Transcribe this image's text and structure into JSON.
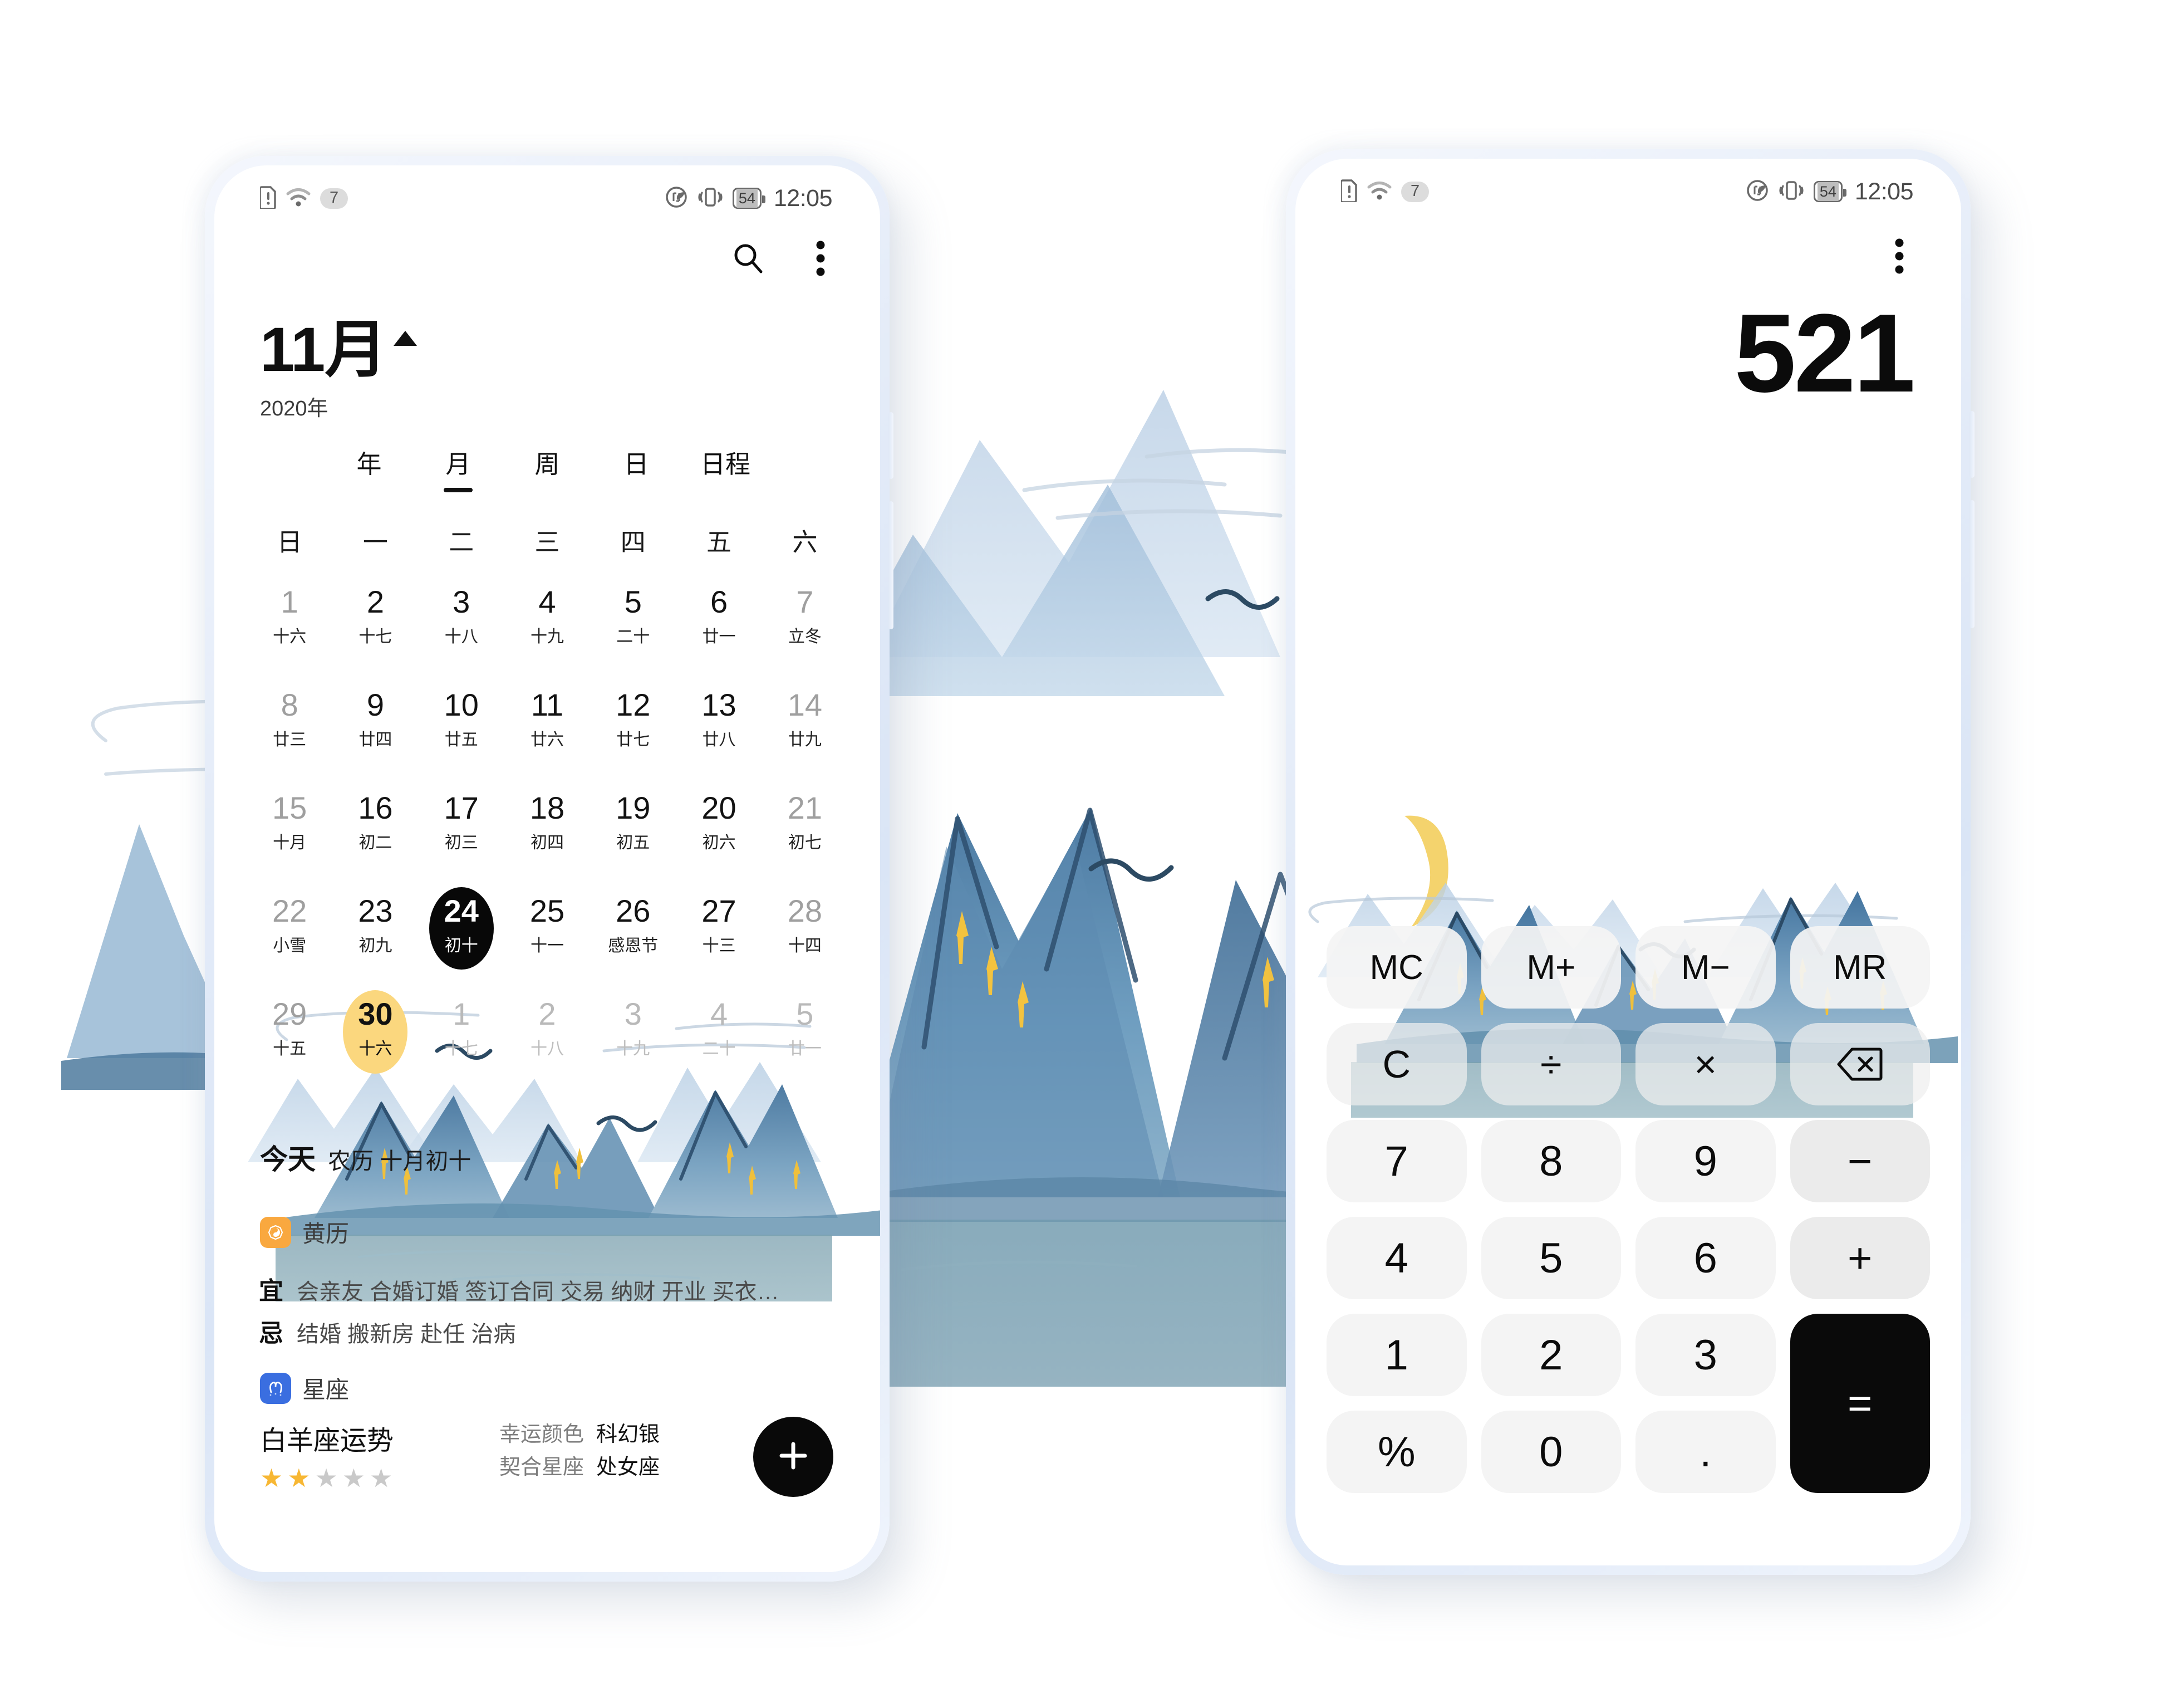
{
  "statusbar": {
    "wifi_count": "7",
    "battery": "54",
    "time": "12:05",
    "icons": [
      "sim-alert-icon",
      "wifi-icon",
      "data-saver-icon",
      "vibrate-icon",
      "battery-icon"
    ]
  },
  "calendar": {
    "search_icon": "search-icon",
    "more_icon": "more-vertical-icon",
    "month": "11月",
    "year": "2020年",
    "tabs": [
      {
        "label": "年",
        "active": false
      },
      {
        "label": "月",
        "active": true
      },
      {
        "label": "周",
        "active": false
      },
      {
        "label": "日",
        "active": false
      },
      {
        "label": "日程",
        "active": false
      }
    ],
    "weekdays": [
      "日",
      "一",
      "二",
      "三",
      "四",
      "五",
      "六"
    ],
    "days": [
      {
        "num": "1",
        "lunar": "十六",
        "state": "weekend"
      },
      {
        "num": "2",
        "lunar": "十七",
        "state": ""
      },
      {
        "num": "3",
        "lunar": "十八",
        "state": ""
      },
      {
        "num": "4",
        "lunar": "十九",
        "state": ""
      },
      {
        "num": "5",
        "lunar": "二十",
        "state": ""
      },
      {
        "num": "6",
        "lunar": "廿一",
        "state": ""
      },
      {
        "num": "7",
        "lunar": "立冬",
        "state": "weekend"
      },
      {
        "num": "8",
        "lunar": "廿三",
        "state": "weekend"
      },
      {
        "num": "9",
        "lunar": "廿四",
        "state": ""
      },
      {
        "num": "10",
        "lunar": "廿五",
        "state": ""
      },
      {
        "num": "11",
        "lunar": "廿六",
        "state": ""
      },
      {
        "num": "12",
        "lunar": "廿七",
        "state": ""
      },
      {
        "num": "13",
        "lunar": "廿八",
        "state": ""
      },
      {
        "num": "14",
        "lunar": "廿九",
        "state": "weekend"
      },
      {
        "num": "15",
        "lunar": "十月",
        "state": "weekend"
      },
      {
        "num": "16",
        "lunar": "初二",
        "state": ""
      },
      {
        "num": "17",
        "lunar": "初三",
        "state": ""
      },
      {
        "num": "18",
        "lunar": "初四",
        "state": ""
      },
      {
        "num": "19",
        "lunar": "初五",
        "state": ""
      },
      {
        "num": "20",
        "lunar": "初六",
        "state": ""
      },
      {
        "num": "21",
        "lunar": "初七",
        "state": "weekend"
      },
      {
        "num": "22",
        "lunar": "小雪",
        "state": "weekend"
      },
      {
        "num": "23",
        "lunar": "初九",
        "state": ""
      },
      {
        "num": "24",
        "lunar": "初十",
        "state": "selected"
      },
      {
        "num": "25",
        "lunar": "十一",
        "state": ""
      },
      {
        "num": "26",
        "lunar": "感恩节",
        "state": ""
      },
      {
        "num": "27",
        "lunar": "十三",
        "state": ""
      },
      {
        "num": "28",
        "lunar": "十四",
        "state": "weekend"
      },
      {
        "num": "29",
        "lunar": "十五",
        "state": "weekend"
      },
      {
        "num": "30",
        "lunar": "十六",
        "state": "today"
      },
      {
        "num": "1",
        "lunar": "十七",
        "state": "dim"
      },
      {
        "num": "2",
        "lunar": "十八",
        "state": "dim"
      },
      {
        "num": "3",
        "lunar": "十九",
        "state": "dim"
      },
      {
        "num": "4",
        "lunar": "二十",
        "state": "dim"
      },
      {
        "num": "5",
        "lunar": "廿一",
        "state": "dim"
      }
    ],
    "today_label": "今天",
    "today_lunar": "农历 十月初十",
    "almanac": {
      "badge_icon": "bagua-yinyang-icon",
      "badge_color": "#f9a83f",
      "title": "黄历",
      "good_key": "宜",
      "good_value": "会亲友 合婚订婚 签订合同 交易 纳财 开业 买衣…",
      "bad_key": "忌",
      "bad_value": "结婚 搬新房 赴任 治病"
    },
    "zodiac": {
      "badge_icon": "aries-icon",
      "badge_color": "#3a6ee0",
      "title": "星座",
      "sign_label": "白羊座运势",
      "rating": 2,
      "rating_max": 5,
      "star_on_color": "#f7b733",
      "star_off_color": "#c9c9c9",
      "lucky_color_key": "幸运颜色",
      "lucky_color_value": "科幻银",
      "match_key": "契合星座",
      "match_value": "处女座"
    },
    "fab_icon": "plus-icon"
  },
  "calculator": {
    "more_icon": "more-vertical-icon",
    "display": "521",
    "keys": [
      {
        "label": "MC",
        "kind": "mem",
        "name": "memory-clear-key"
      },
      {
        "label": "M+",
        "kind": "mem",
        "name": "memory-add-key"
      },
      {
        "label": "M−",
        "kind": "mem",
        "name": "memory-subtract-key"
      },
      {
        "label": "MR",
        "kind": "mem",
        "name": "memory-recall-key"
      },
      {
        "label": "C",
        "kind": "op",
        "name": "clear-key"
      },
      {
        "label": "÷",
        "kind": "op",
        "name": "divide-key"
      },
      {
        "label": "×",
        "kind": "op",
        "name": "multiply-key"
      },
      {
        "label": "",
        "kind": "op",
        "name": "backspace-key",
        "icon": "backspace-icon"
      },
      {
        "label": "7",
        "kind": "num",
        "name": "digit-7-key"
      },
      {
        "label": "8",
        "kind": "num",
        "name": "digit-8-key"
      },
      {
        "label": "9",
        "kind": "num",
        "name": "digit-9-key"
      },
      {
        "label": "−",
        "kind": "fn",
        "name": "minus-key"
      },
      {
        "label": "4",
        "kind": "num",
        "name": "digit-4-key"
      },
      {
        "label": "5",
        "kind": "num",
        "name": "digit-5-key"
      },
      {
        "label": "6",
        "kind": "num",
        "name": "digit-6-key"
      },
      {
        "label": "+",
        "kind": "fn",
        "name": "plus-key"
      },
      {
        "label": "1",
        "kind": "num",
        "name": "digit-1-key"
      },
      {
        "label": "2",
        "kind": "num",
        "name": "digit-2-key"
      },
      {
        "label": "3",
        "kind": "num",
        "name": "digit-3-key"
      },
      {
        "label": "=",
        "kind": "eq",
        "name": "equals-key"
      },
      {
        "label": "%",
        "kind": "num",
        "name": "percent-key"
      },
      {
        "label": "0",
        "kind": "num",
        "name": "digit-0-key"
      },
      {
        "label": ".",
        "kind": "num",
        "name": "decimal-point-key"
      }
    ]
  },
  "theme": {
    "accent_yellow": "#fbd77e",
    "accent_orange": "#f9a83f",
    "accent_blue": "#3a6ee0",
    "ink_blue": "#5d87ad",
    "black": "#0a0a0a"
  }
}
